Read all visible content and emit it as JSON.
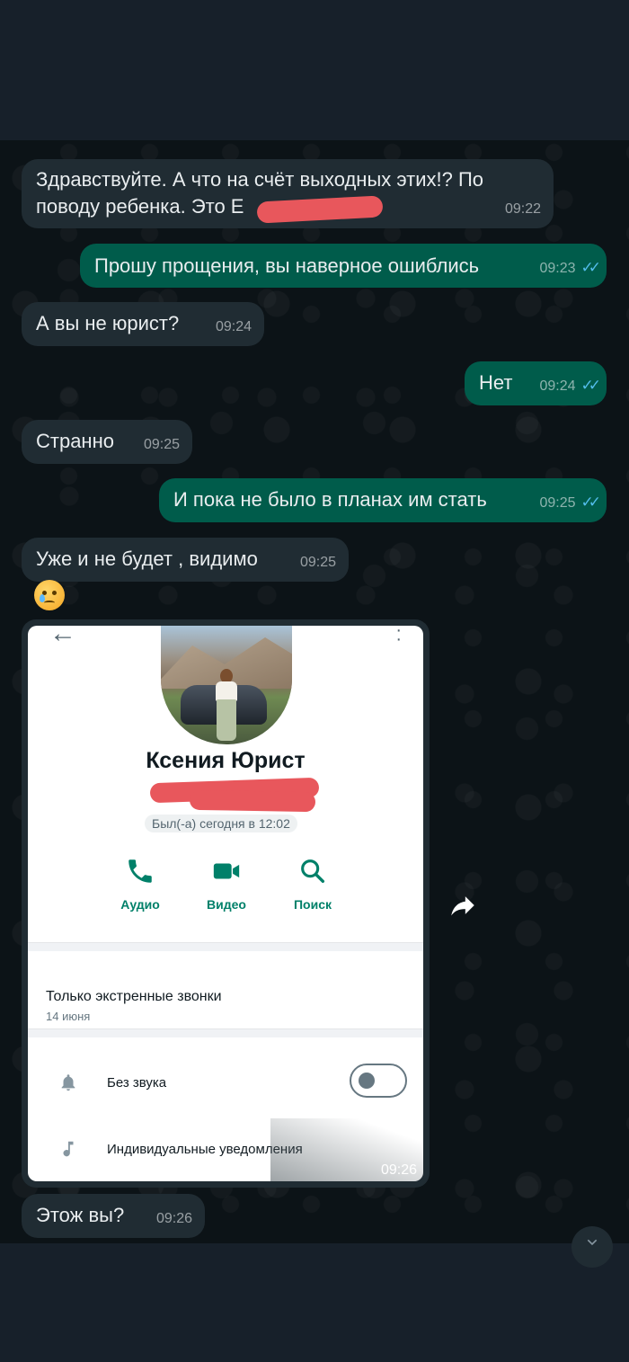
{
  "messages": [
    {
      "text": "Здравствуйте. А что на счёт выходных этих!? По поводу ребенка. Это Е",
      "time": "09:22",
      "dir": "in"
    },
    {
      "text": "Прошу прощения, вы наверное ошиблись",
      "time": "09:23",
      "dir": "out",
      "status": "read"
    },
    {
      "text": "А вы не юрист?",
      "time": "09:24",
      "dir": "in"
    },
    {
      "text": "Нет",
      "time": "09:24",
      "dir": "out",
      "status": "read"
    },
    {
      "text": "Странно",
      "time": "09:25",
      "dir": "in"
    },
    {
      "text": "И пока не было в планах им стать",
      "time": "09:25",
      "dir": "out",
      "status": "read"
    },
    {
      "text": "Уже и не будет , видимо",
      "time": "09:25",
      "dir": "in"
    },
    {
      "emoji": "😢",
      "dir": "in"
    },
    {
      "image_time": "09:26",
      "dir": "in"
    },
    {
      "text": "Этож вы?",
      "time": "09:26",
      "dir": "in"
    }
  ],
  "msg0_line1": "Здравствуйте. А что на счёт выходных этих!? По",
  "msg0_line2": "поводу ребенка. Это Е",
  "ticks": "✓✓",
  "screenshot": {
    "contact_name": "Ксения Юрист",
    "last_seen": "Был(-а) сегодня в 12:02",
    "actions": [
      {
        "label": "Аудио",
        "icon": "phone-icon"
      },
      {
        "label": "Видео",
        "icon": "video-icon"
      },
      {
        "label": "Поиск",
        "icon": "search-icon"
      }
    ],
    "emergency_title": "Только экстренные звонки",
    "emergency_date": "14 июня",
    "mute_label": "Без звука",
    "mute_on": false,
    "custom_notif_label": "Индивидуальные уведомления"
  },
  "colors": {
    "incoming": "#202c33",
    "outgoing": "#005c4b",
    "read_ticks": "#53bdeb",
    "accent": "#008069",
    "redaction": "#e8575c"
  }
}
